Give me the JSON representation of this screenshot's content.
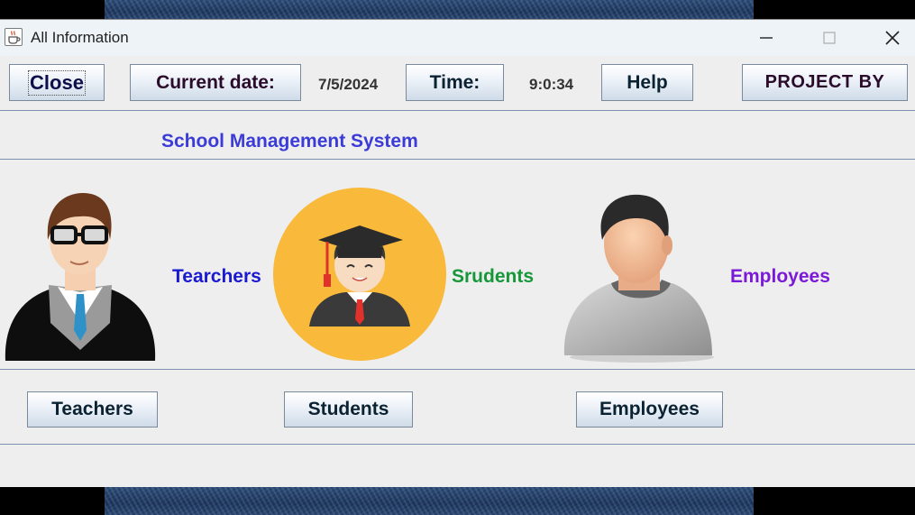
{
  "window": {
    "title": "All Information",
    "controls": [
      "minimize-icon",
      "maximize-icon",
      "close-icon"
    ]
  },
  "toolbar": {
    "close_label": "Close",
    "current_date_label": "Current date:",
    "current_date_value": "7/5/2024",
    "time_label": "Time:",
    "time_value": "9:0:34",
    "help_label": "Help",
    "project_by_label": "PROJECT BY"
  },
  "main": {
    "heading": "School Management System",
    "sections": [
      {
        "icon": "teacher-icon",
        "caption": "Tearchers",
        "button_label": "Teachers"
      },
      {
        "icon": "student-graduate-icon",
        "caption": "Srudents",
        "button_label": "Students"
      },
      {
        "icon": "employee-icon",
        "caption": "Employees",
        "button_label": "Employees"
      }
    ]
  },
  "colors": {
    "heading": "#3b3bd8",
    "teachers_caption": "#1a1ad0",
    "students_caption": "#17973a",
    "employees_caption": "#7a1ad8",
    "student_circle": "#f9b93b"
  }
}
